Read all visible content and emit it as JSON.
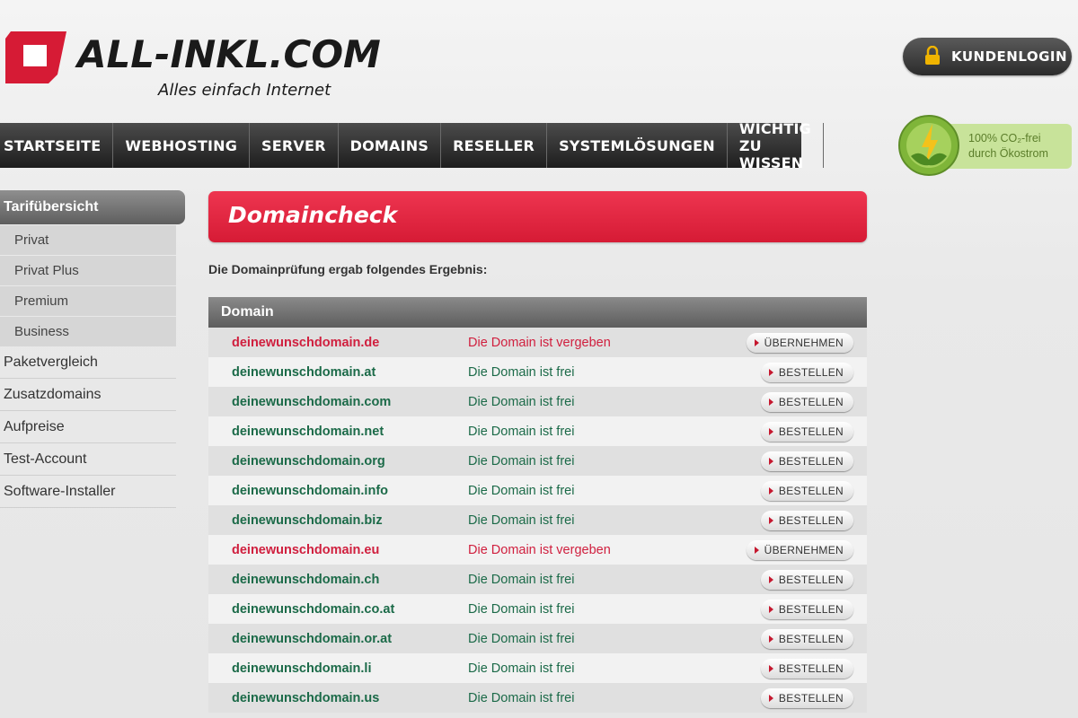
{
  "brand": {
    "name": "ALL-INKL.COM",
    "tagline": "Alles einfach Internet",
    "accent": "#d61b35"
  },
  "login": {
    "label": "KUNDENLOGIN"
  },
  "nav": {
    "items": [
      {
        "label": "STARTSEITE"
      },
      {
        "label": "WEBHOSTING"
      },
      {
        "label": "SERVER"
      },
      {
        "label": "DOMAINS"
      },
      {
        "label": "RESELLER"
      },
      {
        "label": "SYSTEMLÖSUNGEN"
      },
      {
        "label": "WICHTIG ZU WISSEN"
      }
    ]
  },
  "eco": {
    "line1": "100% CO₂-frei",
    "line2": "durch Ökostrom"
  },
  "sidebar": {
    "heading": "Tarifübersicht",
    "subitems": [
      {
        "label": "Privat"
      },
      {
        "label": "Privat Plus"
      },
      {
        "label": "Premium"
      },
      {
        "label": "Business"
      }
    ],
    "items": [
      {
        "label": "Paketvergleich"
      },
      {
        "label": "Zusatzdomains"
      },
      {
        "label": "Aufpreise"
      },
      {
        "label": "Test-Account"
      },
      {
        "label": "Software-Installer"
      }
    ]
  },
  "main": {
    "title": "Domaincheck",
    "intro": "Die Domainprüfung ergab folgendes Ergebnis:",
    "table_header": "Domain",
    "rows": [
      {
        "domain": "deinewunschdomain.de",
        "status": "Die Domain ist vergeben",
        "action": "ÜBERNEHMEN"
      },
      {
        "domain": "deinewunschdomain.at",
        "status": "Die Domain ist frei",
        "action": "BESTELLEN"
      },
      {
        "domain": "deinewunschdomain.com",
        "status": "Die Domain ist frei",
        "action": "BESTELLEN"
      },
      {
        "domain": "deinewunschdomain.net",
        "status": "Die Domain ist frei",
        "action": "BESTELLEN"
      },
      {
        "domain": "deinewunschdomain.org",
        "status": "Die Domain ist frei",
        "action": "BESTELLEN"
      },
      {
        "domain": "deinewunschdomain.info",
        "status": "Die Domain ist frei",
        "action": "BESTELLEN"
      },
      {
        "domain": "deinewunschdomain.biz",
        "status": "Die Domain ist frei",
        "action": "BESTELLEN"
      },
      {
        "domain": "deinewunschdomain.eu",
        "status": "Die Domain ist vergeben",
        "action": "ÜBERNEHMEN"
      },
      {
        "domain": "deinewunschdomain.ch",
        "status": "Die Domain ist frei",
        "action": "BESTELLEN"
      },
      {
        "domain": "deinewunschdomain.co.at",
        "status": "Die Domain ist frei",
        "action": "BESTELLEN"
      },
      {
        "domain": "deinewunschdomain.or.at",
        "status": "Die Domain ist frei",
        "action": "BESTELLEN"
      },
      {
        "domain": "deinewunschdomain.li",
        "status": "Die Domain ist frei",
        "action": "BESTELLEN"
      },
      {
        "domain": "deinewunschdomain.us",
        "status": "Die Domain ist frei",
        "action": "BESTELLEN"
      }
    ]
  },
  "colors": {
    "free": "#1b6a48",
    "taken": "#d01f3e",
    "eco": "#c8e39a"
  }
}
